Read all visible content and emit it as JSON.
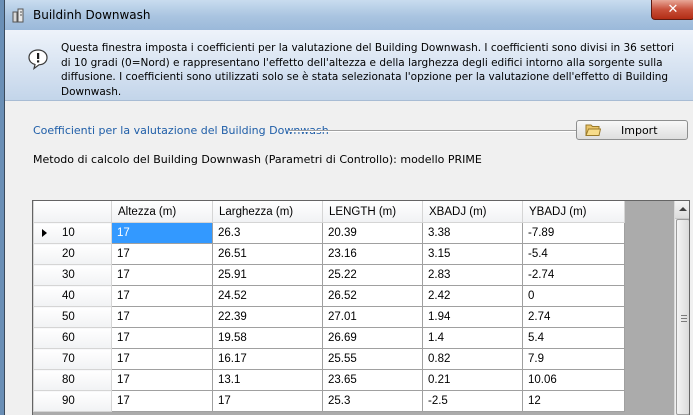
{
  "window": {
    "title": "Buildinh Downwash",
    "close_label": "✕"
  },
  "info": {
    "text": "Questa finestra imposta i coefficienti per la valutazione del Building Downwash. I coefficienti sono divisi in 36 settori di 10 gradi (0=Nord) e rappresentano l'effetto dell'altezza e della larghezza degli edifici intorno alla sorgente sulla diffusione. I coefficienti sono utilizzati solo se è stata selezionata l'opzione per la valutazione dell'effetto di Building Downwash."
  },
  "section": {
    "title": "Coefficienti per la valutazione del Building Downwash",
    "import_label": "Import",
    "method_label": "Metodo di calcolo del Building Downwash (Parametri di Controllo): modello PRIME"
  },
  "grid": {
    "columns": [
      "Altezza (m)",
      "Larghezza (m)",
      "LENGTH (m)",
      "XBADJ (m)",
      "YBADJ (m)"
    ],
    "rows": [
      {
        "sector": "10",
        "cells": [
          "17",
          "26.3",
          "20.39",
          "3.38",
          "-7.89"
        ]
      },
      {
        "sector": "20",
        "cells": [
          "17",
          "26.51",
          "23.16",
          "3.15",
          "-5.4"
        ]
      },
      {
        "sector": "30",
        "cells": [
          "17",
          "25.91",
          "25.22",
          "2.83",
          "-2.74"
        ]
      },
      {
        "sector": "40",
        "cells": [
          "17",
          "24.52",
          "26.52",
          "2.42",
          "0"
        ]
      },
      {
        "sector": "50",
        "cells": [
          "17",
          "22.39",
          "27.01",
          "1.94",
          "2.74"
        ]
      },
      {
        "sector": "60",
        "cells": [
          "17",
          "19.58",
          "26.69",
          "1.4",
          "5.4"
        ]
      },
      {
        "sector": "70",
        "cells": [
          "17",
          "16.17",
          "25.55",
          "0.82",
          "7.9"
        ]
      },
      {
        "sector": "80",
        "cells": [
          "17",
          "13.1",
          "23.65",
          "0.21",
          "10.06"
        ]
      },
      {
        "sector": "90",
        "cells": [
          "17",
          "17",
          "25.3",
          "-2.5",
          "12"
        ]
      }
    ],
    "selected_row": 0,
    "selected_col": 0
  }
}
